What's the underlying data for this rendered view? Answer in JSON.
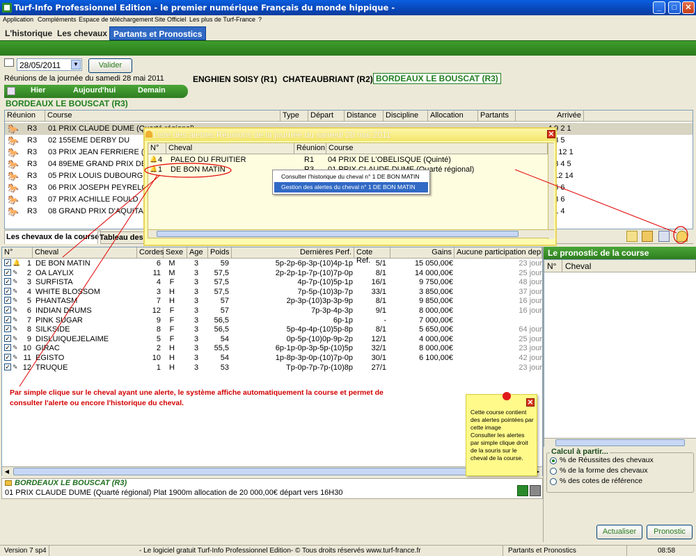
{
  "window": {
    "title": "Turf-Info Professionnel Edition - le premier numérique Français du monde hippique -"
  },
  "menu": [
    "Application",
    "Compléments",
    "Espace de téléchargement",
    "Site Officiel",
    "Les plus de Turf-France",
    "?"
  ],
  "tabs": [
    "L'historique",
    "Les chevaux",
    "Partants et Pronostics"
  ],
  "date": {
    "value": "28/05/2011",
    "validate_label": "Valider"
  },
  "meetings_day_label": "Réunions de la journée du samedi 28 mai 2011",
  "nav": {
    "prev": "Hier",
    "today": "Aujourd'hui",
    "next": "Demain"
  },
  "meetings": [
    "ENGHIEN SOISY (R1)",
    "CHATEAUBRIANT (R2)",
    "BORDEAUX LE BOUSCAT (R3)"
  ],
  "selected_meeting": "BORDEAUX LE BOUSCAT (R3)",
  "races_table": {
    "headers": [
      "Réunion",
      "Course",
      "Type",
      "Départ",
      "Distance",
      "Discipline",
      "Allocation",
      "Partants",
      "Arrivée"
    ],
    "rows": [
      {
        "reunion": "R3",
        "course": "01 PRIX CLAUDE DUME (Quarté régional)",
        "arrivee": "4 9 2 1"
      },
      {
        "reunion": "R3",
        "course": "02 155EME DERBY DU",
        "arrivee": "6 3 5"
      },
      {
        "reunion": "R3",
        "course": "03 PRIX JEAN FERRIERE (M",
        "arrivee": "10 12 1"
      },
      {
        "reunion": "R3",
        "course": "04 89EME GRAND PRIX DE B",
        "arrivee": "1 3 4 5"
      },
      {
        "reunion": "R3",
        "course": "05 PRIX LOUIS DUBOURG (M",
        "arrivee": "2 12 14"
      },
      {
        "reunion": "R3",
        "course": "06 PRIX JOSEPH PEYRELON",
        "arrivee": "2 5 6"
      },
      {
        "reunion": "R3",
        "course": "07 PRIX ACHILLE FOULD",
        "arrivee": "5 3 6"
      },
      {
        "reunion": "R3",
        "course": "08 GRAND PRIX D'AQUITAINE",
        "arrivee": "5 1 4"
      }
    ]
  },
  "subtabs": [
    "Les chevaux de la course",
    "Tableau des"
  ],
  "horses_table": {
    "headers": [
      "N°",
      "Cheval",
      "Cordes",
      "Sexe",
      "Age",
      "Poids",
      "Dernières Perf.",
      "Cote Ref.",
      "Gains",
      "Aucune participation depui"
    ],
    "rows": [
      {
        "num": "1",
        "name": "DE BON MATIN",
        "cordes": "6",
        "sexe": "M",
        "age": "3",
        "poids": "59",
        "perf": "5p-2p-6p-3p-(10)4p-1p",
        "cote": "5/1",
        "gains": "15 050,00€",
        "last": "23 jour"
      },
      {
        "num": "2",
        "name": "OA LAYLIX",
        "cordes": "11",
        "sexe": "M",
        "age": "3",
        "poids": "57,5",
        "perf": "2p-2p-1p-7p-(10)7p-0p",
        "cote": "8/1",
        "gains": "14 000,00€",
        "last": "25 jour"
      },
      {
        "num": "3",
        "name": "SURFISTA",
        "cordes": "4",
        "sexe": "F",
        "age": "3",
        "poids": "57,5",
        "perf": "4p-7p-(10)5p-1p",
        "cote": "16/1",
        "gains": "9 750,00€",
        "last": "48 jour"
      },
      {
        "num": "4",
        "name": "WHITE BLOSSOM",
        "cordes": "3",
        "sexe": "H",
        "age": "3",
        "poids": "57,5",
        "perf": "7p-5p-(10)3p-7p",
        "cote": "33/1",
        "gains": "3 850,00€",
        "last": "37 jour"
      },
      {
        "num": "5",
        "name": "PHANTASM",
        "cordes": "7",
        "sexe": "H",
        "age": "3",
        "poids": "57",
        "perf": "2p-3p-(10)3p-3p-9p",
        "cote": "8/1",
        "gains": "9 850,00€",
        "last": "16 jour"
      },
      {
        "num": "6",
        "name": "INDIAN DRUMS",
        "cordes": "12",
        "sexe": "F",
        "age": "3",
        "poids": "57",
        "perf": "7p-3p-4p-3p",
        "cote": "9/1",
        "gains": "8 000,00€",
        "last": "16 jour"
      },
      {
        "num": "7",
        "name": "PINK SUGAR",
        "cordes": "9",
        "sexe": "F",
        "age": "3",
        "poids": "56,5",
        "perf": "6p-1p",
        "cote": "-",
        "gains": "7 000,00€",
        "last": ""
      },
      {
        "num": "8",
        "name": "SILKSIDE",
        "cordes": "8",
        "sexe": "F",
        "age": "3",
        "poids": "56,5",
        "perf": "5p-4p-4p-(10)5p-8p",
        "cote": "8/1",
        "gains": "5 650,00€",
        "last": "64 jour"
      },
      {
        "num": "9",
        "name": "DISLUIQUEJELAIME",
        "cordes": "5",
        "sexe": "F",
        "age": "3",
        "poids": "54",
        "perf": "0p-5p-(10)0p-9p-2p",
        "cote": "12/1",
        "gains": "4 000,00€",
        "last": "25 jour"
      },
      {
        "num": "10",
        "name": "GIRAC",
        "cordes": "2",
        "sexe": "H",
        "age": "3",
        "poids": "55,5",
        "perf": "6p-1p-0p-3p-5p-(10)5p",
        "cote": "32/1",
        "gains": "8 000,00€",
        "last": "23 jour"
      },
      {
        "num": "11",
        "name": "EGISTO",
        "cordes": "10",
        "sexe": "H",
        "age": "3",
        "poids": "54",
        "perf": "1p-8p-3p-0p-(10)7p-0p",
        "cote": "30/1",
        "gains": "6 100,00€",
        "last": "42 jour"
      },
      {
        "num": "12",
        "name": "TRUQUE",
        "cordes": "1",
        "sexe": "H",
        "age": "3",
        "poids": "53",
        "perf": "Tp-0p-7p-7p-(10)8p",
        "cote": "27/1",
        "gains": "",
        "last": "23 jour"
      }
    ]
  },
  "alert_window": {
    "title": "Liste des alertes.Réunions de la journée du samedi 28 mai 2011",
    "headers": [
      "N°",
      "Cheval",
      "Réunion",
      "Course"
    ],
    "rows": [
      {
        "num": "4",
        "name": "PALEO DU FRUITIER",
        "reunion": "R1",
        "course": "04 PRIX DE L'OBELISQUE (Quinté)"
      },
      {
        "num": "1",
        "name": "DE BON MATIN",
        "reunion": "R3",
        "course": "01 PRIX CLAUDE DUME (Quarté régional)"
      }
    ]
  },
  "context_menu": [
    "Consulter l'historique du cheval n° 1 DE BON MATIN",
    "Gestion des alertes du cheval n° 1 DE BON MATIN"
  ],
  "annotation": "Par simple clique sur le cheval ayant une alerte, le système affiche automatiquement la course et permet de consulter l'alerte ou encore l'historique du cheval.",
  "sticky_note": {
    "line1": "Cette course contient des alertes pointées par cette image",
    "line2": "Consulter les alertes par simple clique droit de la souris sur le cheval de la course."
  },
  "prono": {
    "title": "Le pronostic de la course",
    "headers": [
      "N°",
      "Cheval"
    ],
    "calc_title": "Calcul à partir...",
    "options": [
      "% de Réussites des chevaux",
      "% de la forme des chevaux",
      "% des cotes de référence"
    ],
    "actualiser": "Actualiser",
    "pronostic": "Pronostic"
  },
  "race_info": {
    "meeting": "BORDEAUX LE BOUSCAT (R3)",
    "detail": "01 PRIX CLAUDE DUME (Quarté régional) Plat 1900m allocation de 20 000,00€ départ vers 16H30"
  },
  "status": {
    "version": "Version 7 sp4",
    "center": "- Le logiciel gratuit Turf-Info Professionnel Edition- © Tous droits réservés www.turf-france.fr",
    "section": "Partants et Pronostics",
    "time": "08:58"
  }
}
